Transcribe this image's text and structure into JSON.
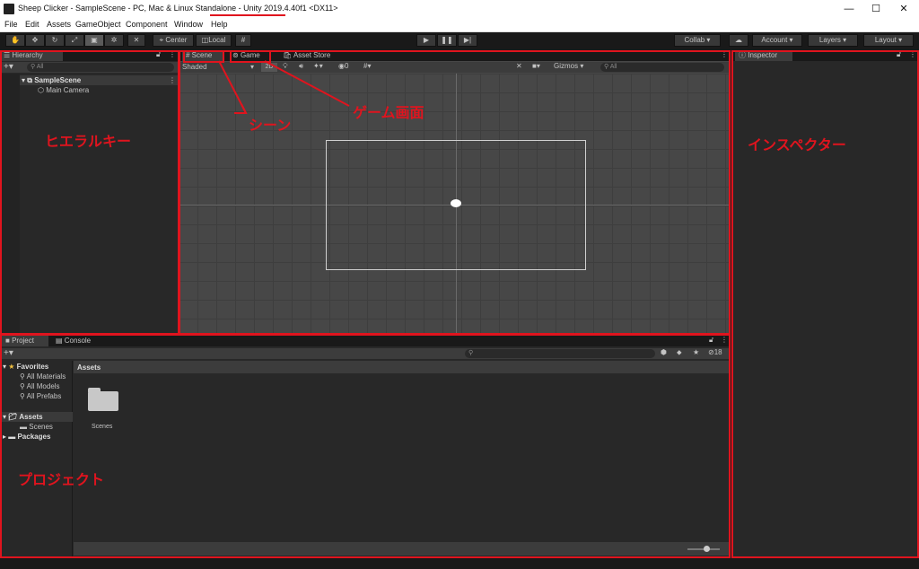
{
  "window": {
    "title_prefix": "Sheep Clicker - SampleScene - PC, Mac & Linux Standalone - ",
    "title_version": "Unity 2019.4.40f1",
    "title_suffix": " <DX11>",
    "minimize": "—",
    "maximize": "☐",
    "close": "✕"
  },
  "menu": [
    "File",
    "Edit",
    "Assets",
    "GameObject",
    "Component",
    "Window",
    "Help"
  ],
  "toolbar": {
    "center": "Center",
    "local": "Local",
    "collab": "Collab ▾",
    "account": "Account ▾",
    "layers": "Layers ▾",
    "layout": "Layout ▾",
    "play": "▶",
    "pause": "❚❚",
    "step": "▶|"
  },
  "hierarchy": {
    "tab": "Hierarchy",
    "search_placeholder": "All",
    "scene": "SampleScene",
    "items": [
      "Main Camera"
    ],
    "annotation": "ヒエラルキー"
  },
  "scene": {
    "tabs": [
      "Scene",
      "Game",
      "Asset Store"
    ],
    "shading": "Shaded",
    "mode_2d": "2D",
    "hidden_count": "0",
    "gizmos": "Gizmos ▾",
    "search_placeholder": "All",
    "annotation_scene": "シーン",
    "annotation_game": "ゲーム画面"
  },
  "inspector": {
    "tab": "Inspector",
    "annotation": "インスペクター"
  },
  "project": {
    "tabs": [
      "Project",
      "Console"
    ],
    "favorites_label": "Favorites",
    "favorites": [
      "All Materials",
      "All Models",
      "All Prefabs"
    ],
    "assets_label": "Assets",
    "assets_children": [
      "Scenes"
    ],
    "packages_label": "Packages",
    "breadcrumb": "Assets",
    "folder_name": "Scenes",
    "hidden_packages": "18",
    "annotation": "プロジェクト"
  },
  "colors": {
    "accent_red": "#e0141e",
    "panel_bg": "#282828",
    "grid_bg": "#474747"
  }
}
